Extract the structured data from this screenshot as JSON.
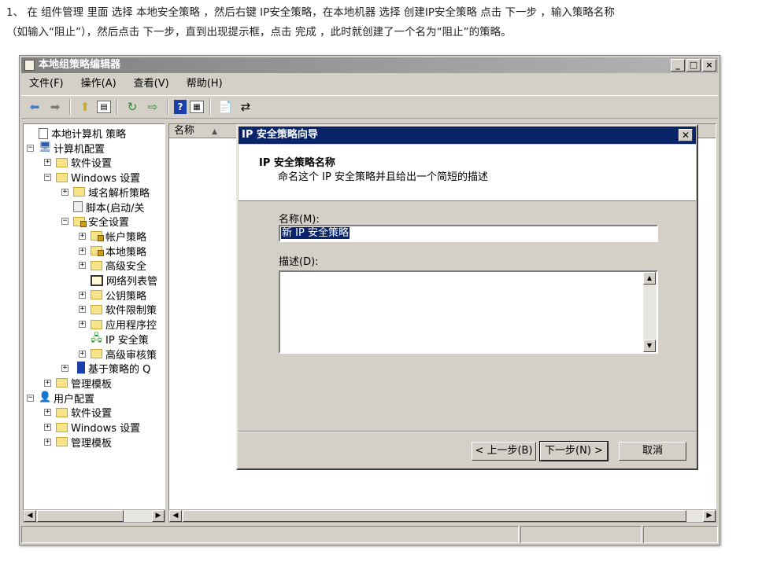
{
  "instruction": {
    "line1": "1、 在 组件管理 里面 选择 本地安全策略 ，然后右键 IP安全策略，在本地机器 选择 创建IP安全策略 点击 下一步 ，输入策略名称",
    "line2": "（如输入“阻止”），然后点击 下一步，直到出现提示框，点击 完成 ，此时就创建了一个名为“阻止”的策略。"
  },
  "window": {
    "title": "本地组策略编辑器",
    "caption_buttons": [
      "_",
      "□",
      "×"
    ]
  },
  "menu": [
    "文件(F)",
    "操作(A)",
    "查看(V)",
    "帮助(H)"
  ],
  "toolbar_icons": [
    "back-arrow-icon",
    "forward-arrow-icon",
    "up-folder-icon",
    "show-hide-tree-icon",
    "refresh-icon",
    "export-list-icon",
    "help-icon",
    "properties-icon",
    "new-policy-icon",
    "assign-icon"
  ],
  "tree": [
    {
      "label": "本地计算机 策略",
      "level": 0,
      "exp": "",
      "icon": "doc"
    },
    {
      "label": "计算机配置",
      "level": 0,
      "exp": "−",
      "icon": "computer"
    },
    {
      "label": "软件设置",
      "level": 1,
      "exp": "+",
      "icon": "folder"
    },
    {
      "label": "Windows 设置",
      "level": 1,
      "exp": "−",
      "icon": "folder"
    },
    {
      "label": "域名解析策略",
      "level": 2,
      "exp": "+",
      "icon": "folder"
    },
    {
      "label": "脚本(启动/关",
      "level": 2,
      "exp": "",
      "icon": "script"
    },
    {
      "label": "安全设置",
      "level": 2,
      "exp": "−",
      "icon": "security"
    },
    {
      "label": "帐户策略",
      "level": 3,
      "exp": "+",
      "icon": "lockfolder"
    },
    {
      "label": "本地策略",
      "level": 3,
      "exp": "+",
      "icon": "lockfolder"
    },
    {
      "label": "高级安全",
      "level": 3,
      "exp": "+",
      "icon": "folder"
    },
    {
      "label": "网络列表管",
      "level": 3,
      "exp": "",
      "icon": "list"
    },
    {
      "label": "公钥策略",
      "level": 3,
      "exp": "+",
      "icon": "folder"
    },
    {
      "label": "软件限制策",
      "level": 3,
      "exp": "+",
      "icon": "folder"
    },
    {
      "label": "应用程序控",
      "level": 3,
      "exp": "+",
      "icon": "folder"
    },
    {
      "label": "IP 安全策",
      "level": 3,
      "exp": "",
      "icon": "ipsec"
    },
    {
      "label": "高级审核策",
      "level": 3,
      "exp": "+",
      "icon": "folder"
    },
    {
      "label": "基于策略的 Q",
      "level": 2,
      "exp": "+",
      "icon": "chart"
    },
    {
      "label": "管理模板",
      "level": 1,
      "exp": "+",
      "icon": "folder"
    },
    {
      "label": "用户配置",
      "level": 0,
      "exp": "−",
      "icon": "user"
    },
    {
      "label": "软件设置",
      "level": 1,
      "exp": "+",
      "icon": "folder"
    },
    {
      "label": "Windows 设置",
      "level": 1,
      "exp": "+",
      "icon": "folder"
    },
    {
      "label": "管理模板",
      "level": 1,
      "exp": "+",
      "icon": "folder"
    }
  ],
  "list": {
    "column_name": "名称",
    "sort_indicator": "▲"
  },
  "dialog": {
    "title": "IP 安全策略向导",
    "header_title": "IP 安全策略名称",
    "header_subtitle": "命名这个 IP 安全策略并且给出一个简短的描述",
    "name_label": "名称(M):",
    "name_value": "新 IP 安全策略",
    "desc_label": "描述(D):",
    "desc_value": "",
    "back_button": "< 上一步(B)",
    "next_button": "下一步(N) >",
    "cancel_button": "取消"
  }
}
